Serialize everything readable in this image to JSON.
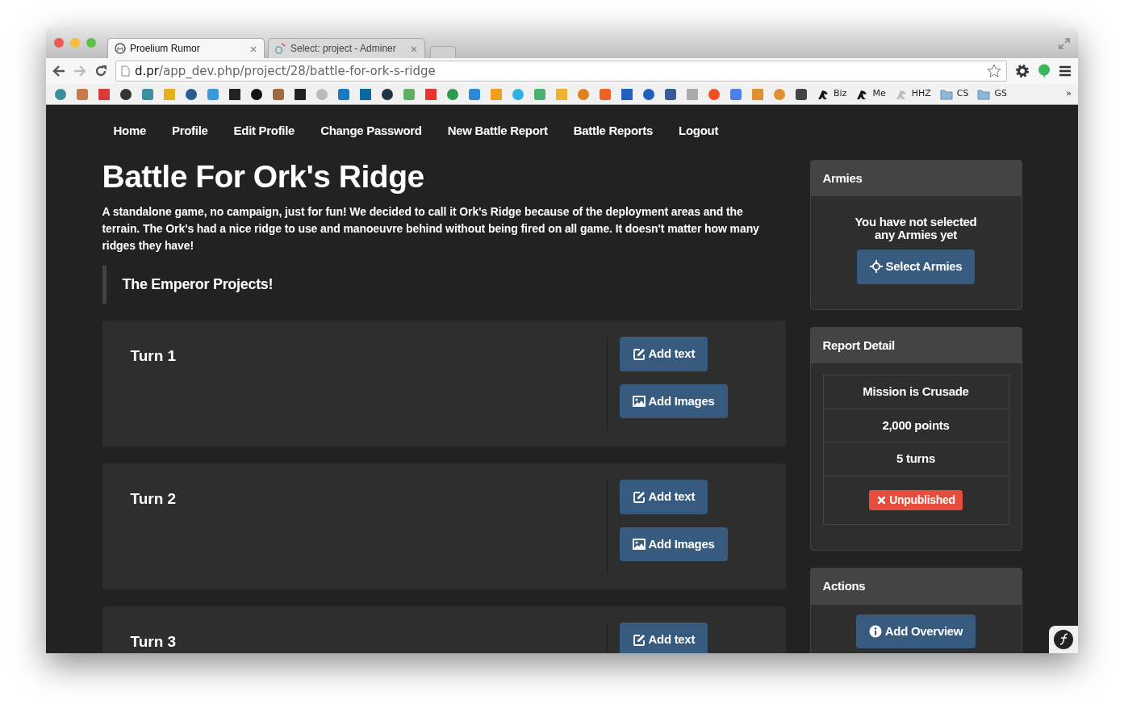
{
  "browser": {
    "tabs": [
      {
        "title": "Proelium Rumor",
        "selected": true
      },
      {
        "title": "Select: project - Adminer",
        "selected": false
      }
    ],
    "url_host": "d.pr",
    "url_path": "/app_dev.php/project/28/battle-for-ork-s-ridge",
    "bookmarks": [
      {
        "kind": "icon",
        "color": "#3a8f9a"
      },
      {
        "kind": "icon",
        "color": "#c8784a"
      },
      {
        "kind": "icon",
        "color": "#d83a3a"
      },
      {
        "kind": "icon",
        "color": "#333333"
      },
      {
        "kind": "icon",
        "color": "#3a8fa0"
      },
      {
        "kind": "icon",
        "color": "#e8b020"
      },
      {
        "kind": "icon",
        "color": "#2a5a90"
      },
      {
        "kind": "icon",
        "color": "#3a9ad9"
      },
      {
        "kind": "icon",
        "color": "#222222"
      },
      {
        "kind": "icon",
        "color": "#111111"
      },
      {
        "kind": "icon",
        "color": "#a06a40"
      },
      {
        "kind": "icon",
        "color": "#222222"
      },
      {
        "kind": "icon",
        "color": "#bbbbbb"
      },
      {
        "kind": "icon",
        "color": "#1a7ac0"
      },
      {
        "kind": "icon",
        "color": "#0a6aa0"
      },
      {
        "kind": "icon",
        "color": "#223344"
      },
      {
        "kind": "icon",
        "color": "#5ab060"
      },
      {
        "kind": "icon",
        "color": "#e83333"
      },
      {
        "kind": "icon",
        "color": "#2a9a50"
      },
      {
        "kind": "icon",
        "color": "#2a8ad8"
      },
      {
        "kind": "icon",
        "color": "#f0a020"
      },
      {
        "kind": "icon",
        "color": "#30b0e0"
      },
      {
        "kind": "icon",
        "color": "#4ab070"
      },
      {
        "kind": "icon",
        "color": "#f0b030"
      },
      {
        "kind": "icon",
        "color": "#e08020"
      },
      {
        "kind": "icon",
        "color": "#f06020"
      },
      {
        "kind": "icon",
        "color": "#2060c0"
      },
      {
        "kind": "icon",
        "color": "#2060c0"
      },
      {
        "kind": "icon",
        "color": "#3b5998"
      },
      {
        "kind": "icon",
        "color": "#aaaaaa"
      },
      {
        "kind": "icon",
        "color": "#f25022"
      },
      {
        "kind": "icon",
        "color": "#4a80e8"
      },
      {
        "kind": "icon",
        "color": "#e09030"
      },
      {
        "kind": "icon",
        "color": "#e09030"
      },
      {
        "kind": "icon",
        "color": "#444444"
      },
      {
        "kind": "labeled",
        "label": "Biz",
        "color": "#111111"
      },
      {
        "kind": "labeled",
        "label": "Me",
        "color": "#111111"
      },
      {
        "kind": "labeled",
        "label": "HHZ",
        "color": "#bbbbbb"
      },
      {
        "kind": "folder",
        "label": "CS",
        "color": "#8fb8d8"
      },
      {
        "kind": "folder",
        "label": "GS",
        "color": "#8fb8d8"
      }
    ],
    "bookmarks_overflow": "»"
  },
  "nav": {
    "links": [
      "Home",
      "Profile",
      "Edit Profile",
      "Change Password",
      "New Battle Report",
      "Battle Reports",
      "Logout"
    ]
  },
  "report": {
    "title": "Battle For Ork's Ridge",
    "description": "A standalone game, no campaign, just for fun! We decided to call it Ork's Ridge because of the deployment areas and the terrain. The Ork's had a nice ridge to use and manoeuvre behind without being fired on all game. It doesn't matter how many ridges they have!",
    "quote": "The Emperor Projects!"
  },
  "turns": [
    {
      "title": "Turn 1",
      "buttons": [
        {
          "label": "Add text",
          "kind": "text"
        },
        {
          "label": "Add Images",
          "kind": "images"
        }
      ]
    },
    {
      "title": "Turn 2",
      "buttons": [
        {
          "label": "Add text",
          "kind": "text"
        },
        {
          "label": "Add Images",
          "kind": "images"
        }
      ]
    },
    {
      "title": "Turn 3",
      "buttons": [
        {
          "label": "Add text",
          "kind": "text"
        }
      ]
    }
  ],
  "sidebar": {
    "armies": {
      "heading": "Armies",
      "message": "You have not selected any Armies yet",
      "button": "Select Armies"
    },
    "details": {
      "heading": "Report Detail",
      "items": [
        "Mission is Crusade",
        "2,000 points",
        "5 turns"
      ],
      "status": {
        "label": "Unpublished",
        "published": false
      }
    },
    "actions": {
      "heading": "Actions",
      "button": "Add Overview"
    }
  }
}
